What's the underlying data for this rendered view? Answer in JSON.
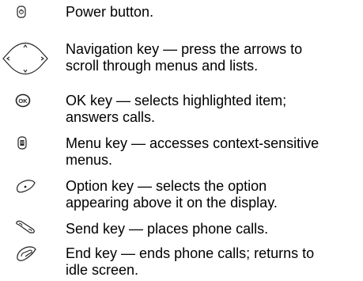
{
  "keys": [
    {
      "icon": "power-button-icon",
      "text": "Power button."
    },
    {
      "icon": "navigation-key-icon",
      "text": "Navigation key — press the arrows to\nscroll through menus and lists."
    },
    {
      "icon": "ok-key-icon",
      "icon_text": "OK",
      "text": "OK key — selects highlighted item;\nanswers calls."
    },
    {
      "icon": "menu-key-icon",
      "text": "Menu key — accesses context-sensitive\nmenus."
    },
    {
      "icon": "option-key-icon",
      "text": "Option key — selects the option\nappearing above it on the display."
    },
    {
      "icon": "send-key-icon",
      "text": "Send key — places phone calls."
    },
    {
      "icon": "end-key-icon",
      "text": "End key — ends phone calls; returns to\nidle screen."
    }
  ]
}
